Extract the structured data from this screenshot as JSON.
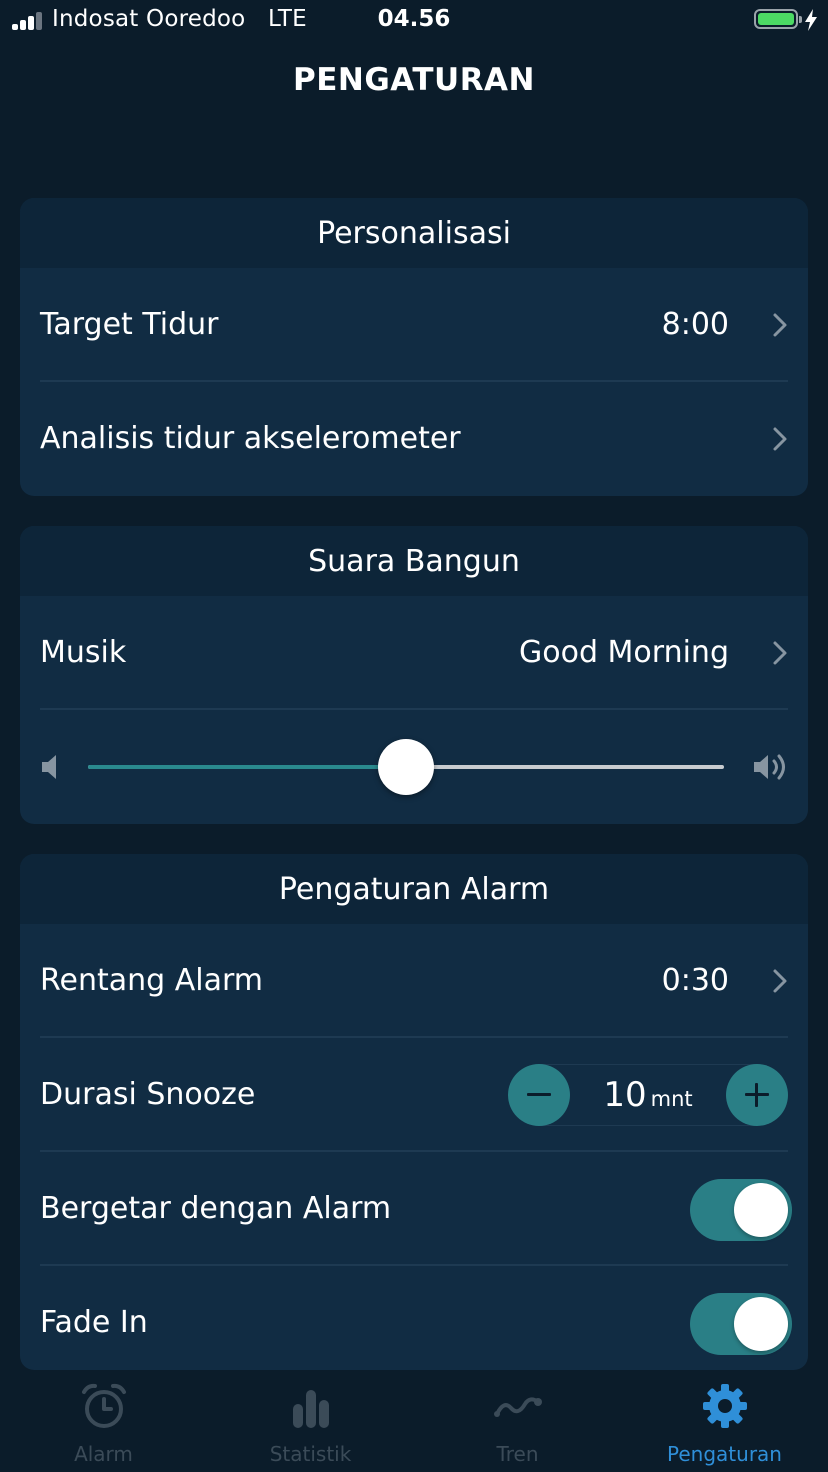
{
  "status_bar": {
    "carrier": "Indosat Ooredoo",
    "network": "LTE",
    "time": "04.56",
    "battery_percent": 100
  },
  "page_title": "PENGATURAN",
  "personalisasi": {
    "header": "Personalisasi",
    "target_tidur": {
      "label": "Target Tidur",
      "value": "8:00"
    },
    "analisis": {
      "label": "Analisis tidur akselerometer"
    }
  },
  "suara_bangun": {
    "header": "Suara Bangun",
    "musik": {
      "label": "Musik",
      "value": "Good Morning"
    },
    "volume_fraction": 0.5
  },
  "pengaturan_alarm": {
    "header": "Pengaturan Alarm",
    "rentang_alarm": {
      "label": "Rentang Alarm",
      "value": "0:30"
    },
    "durasi_snooze": {
      "label": "Durasi Snooze",
      "value": "10",
      "unit": "mnt"
    },
    "bergetar": {
      "label": "Bergetar dengan Alarm",
      "on": true
    },
    "fade_in": {
      "label": "Fade In",
      "on": true
    }
  },
  "tabs": [
    {
      "label": "Alarm",
      "icon": "alarm-clock-icon",
      "active": false
    },
    {
      "label": "Statistik",
      "icon": "bar-chart-icon",
      "active": false
    },
    {
      "label": "Tren",
      "icon": "trend-line-icon",
      "active": false
    },
    {
      "label": "Pengaturan",
      "icon": "gear-icon",
      "active": true
    }
  ],
  "colors": {
    "background": "#0b1c2a",
    "card": "#112c43",
    "card_header": "#0d2539",
    "accent_teal": "#2a7f86",
    "active_tab": "#2f8fd8",
    "inactive_tab": "#3b4b58",
    "battery": "#4cd964"
  }
}
